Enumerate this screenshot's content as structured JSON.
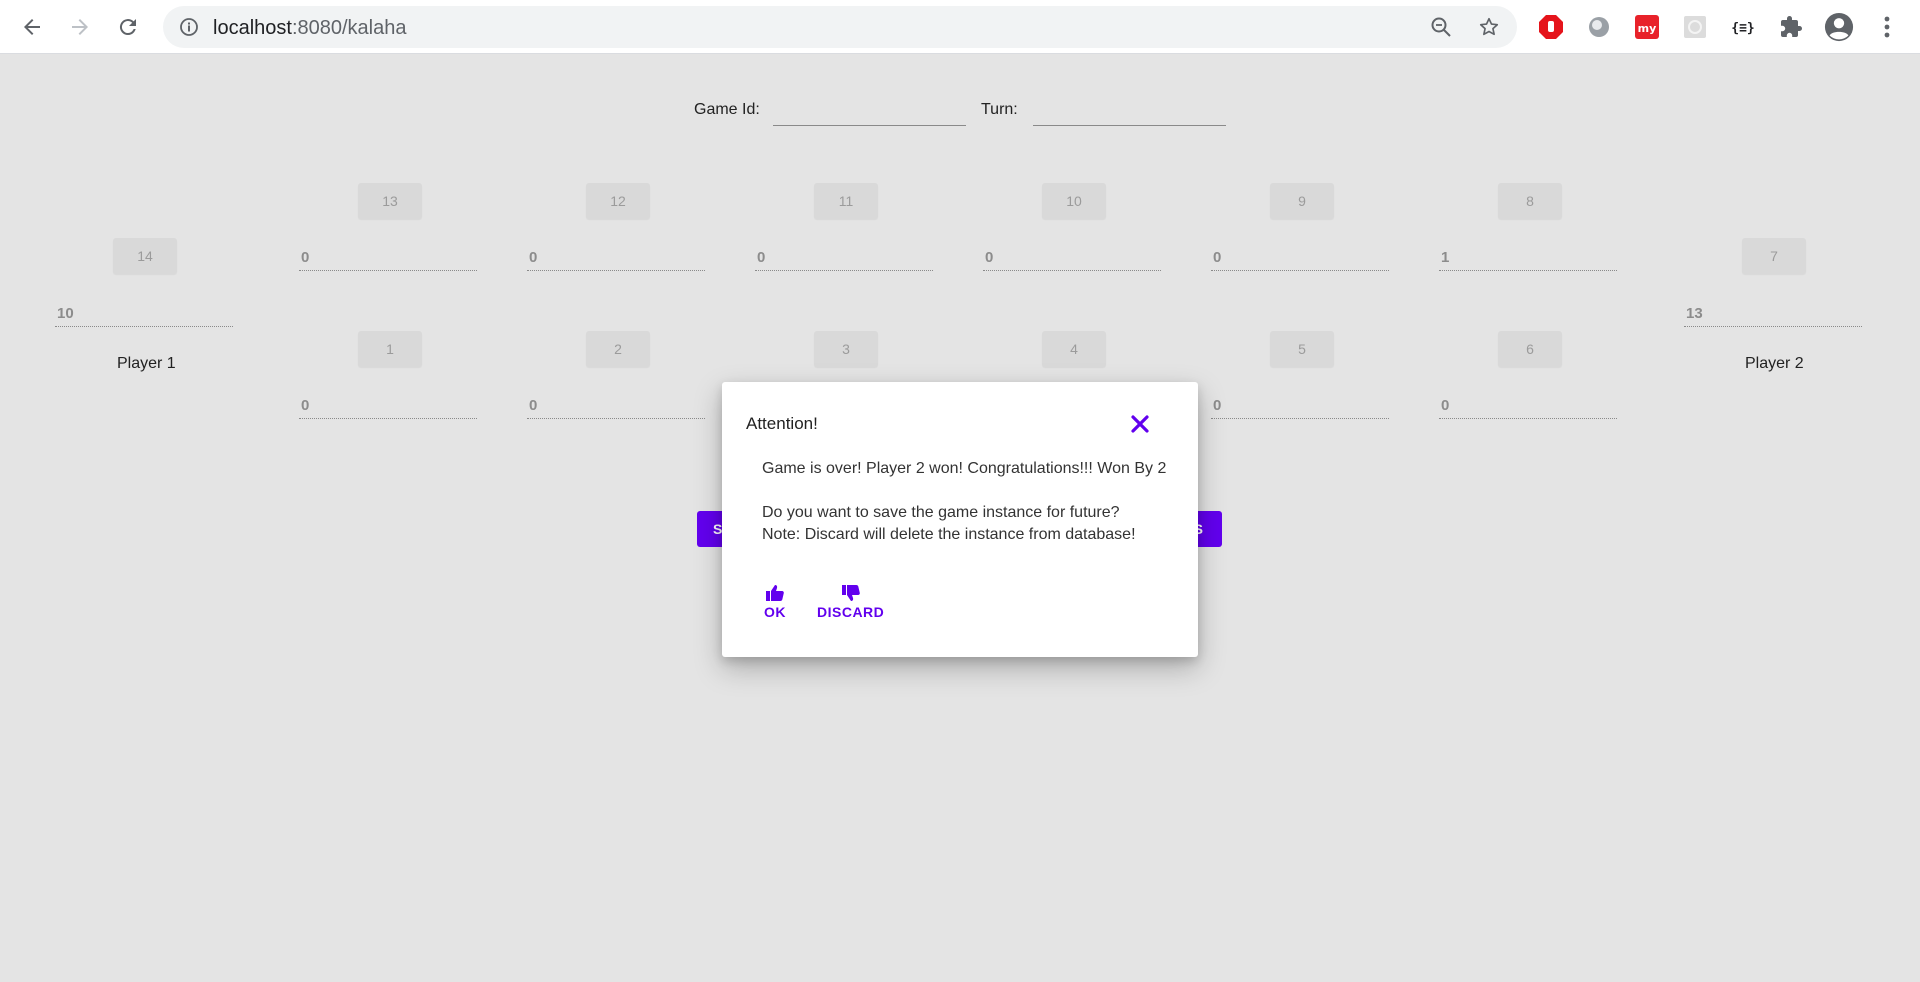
{
  "browser": {
    "url_host": "localhost",
    "url_path": ":8080/kalaha",
    "icons": [
      "back-arrow-icon",
      "forward-arrow-icon",
      "reload-icon",
      "info-icon",
      "zoom-out-icon",
      "star-icon",
      "extensions-icon",
      "profile-icon",
      "menu-dots-icon"
    ]
  },
  "header": {
    "game_id_label": "Game Id:",
    "game_id_value": "",
    "turn_label": "Turn:",
    "turn_value": ""
  },
  "board": {
    "top_pits": [
      {
        "label": "13",
        "value": "0"
      },
      {
        "label": "12",
        "value": "0"
      },
      {
        "label": "11",
        "value": "0"
      },
      {
        "label": "10",
        "value": "0"
      },
      {
        "label": "9",
        "value": "0"
      },
      {
        "label": "8",
        "value": "1"
      }
    ],
    "bottom_pits": [
      {
        "label": "1",
        "value": "0"
      },
      {
        "label": "2",
        "value": "0"
      },
      {
        "label": "3",
        "value": ""
      },
      {
        "label": "4",
        "value": ""
      },
      {
        "label": "5",
        "value": "0"
      },
      {
        "label": "6",
        "value": "0"
      }
    ],
    "left_store": {
      "label": "14",
      "value": "10",
      "player": "Player 1"
    },
    "right_store": {
      "label": "7",
      "value": "13",
      "player": "Player 2"
    }
  },
  "buttons": {
    "left_partial": "S",
    "right_partial": "S"
  },
  "dialog": {
    "title": "Attention!",
    "message_line1": "Game is over! Player 2 won! Congratulations!!! Won By 2",
    "message_line2": "Do you want to save the game instance for future?",
    "message_line3": "Note: Discard will delete the instance from database!",
    "ok_label": "OK",
    "discard_label": "DISCARD"
  },
  "colors": {
    "accent": "#6200ee",
    "page_bg": "#e4e4e4"
  }
}
